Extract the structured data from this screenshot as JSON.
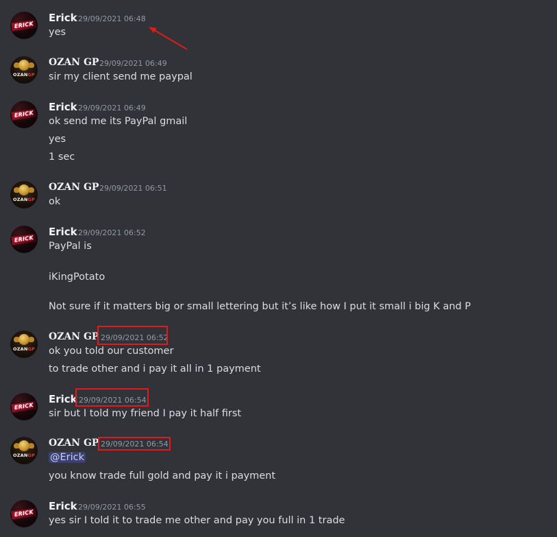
{
  "messages": [
    {
      "author": "Erick",
      "time": "29/09/2021 06:48",
      "lines": [
        "yes"
      ]
    },
    {
      "author": "OZAN GP",
      "time": "29/09/2021 06:49",
      "lines": [
        "sir my client send me paypal"
      ]
    },
    {
      "author": "Erick",
      "time": "29/09/2021 06:49",
      "lines": [
        "ok send me its PayPal gmail",
        "yes",
        "1 sec"
      ]
    },
    {
      "author": "OZAN GP",
      "time": "29/09/2021 06:51",
      "lines": [
        "ok"
      ]
    },
    {
      "author": "Erick",
      "time": "29/09/2021 06:52",
      "lines": [
        "PayPal is",
        "iKingPotato",
        "Not sure if it matters big or small lettering but it’s like how I put it small i big K and P"
      ]
    },
    {
      "author": "OZAN GP",
      "time": "29/09/2021 06:52",
      "lines": [
        "ok you told our customer",
        "to trade other and i pay it all in 1 payment"
      ]
    },
    {
      "author": "Erick",
      "time": "29/09/2021 06:54",
      "lines": [
        "sir but I told my friend I pay it half first"
      ]
    },
    {
      "author": "OZAN GP",
      "time": "29/09/2021 06:54",
      "mention": "@Erick",
      "lines": [
        "you know trade full gold and pay it i payment"
      ]
    },
    {
      "author": "Erick",
      "time": "29/09/2021 06:55",
      "lines": [
        "yes sir I told it to trade me other and pay you full in 1 trade"
      ]
    }
  ],
  "avatar_text": {
    "erick": "ERICK",
    "ozan_a": "OZAN",
    "ozan_b": "GP"
  },
  "colors": {
    "background": "#313338",
    "annotation": "#e01b1b",
    "mention_bg": "#5865f2"
  }
}
